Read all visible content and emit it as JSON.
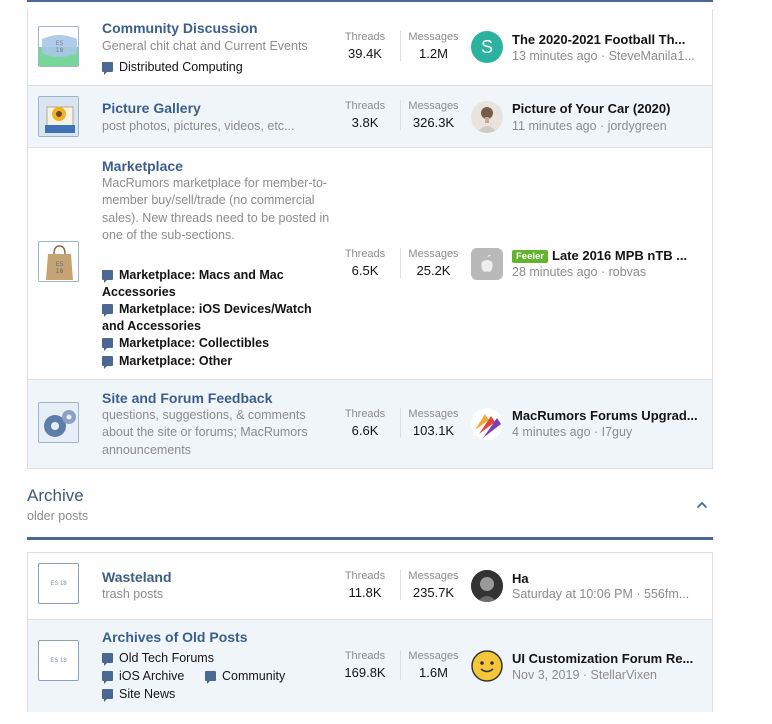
{
  "forums_block": {
    "rows": [
      {
        "title": "Community Discussion",
        "description": "General chit chat and Current Events",
        "subforums": [
          "Distributed Computing"
        ],
        "threads_label": "Threads",
        "threads": "39.4K",
        "messages_label": "Messages",
        "messages": "1.2M",
        "latest_title": "The 2020-2021 Football Th...",
        "latest_meta": "13 minutes ago · SteveManila1...",
        "avatar_letter": "S",
        "avatar_color": "#2bb3a0"
      },
      {
        "title": "Picture Gallery",
        "description": "post photos, pictures, videos, etc...",
        "threads_label": "Threads",
        "threads": "3.8K",
        "messages_label": "Messages",
        "messages": "326.3K",
        "latest_title": "Picture of Your Car (2020)",
        "latest_meta": "11 minutes ago · jordygreen"
      },
      {
        "title": "Marketplace",
        "description": "MacRumors marketplace for member-to-member buy/sell/trade (no commercial sales). New threads need to be posted in one of the sub-sections.",
        "subforums": [
          "Marketplace: Macs and Mac Accessories",
          "Marketplace: iOS Devices/Watch and Accessories",
          "Marketplace: Collectibles",
          "Marketplace: Other"
        ],
        "threads_label": "Threads",
        "threads": "6.5K",
        "messages_label": "Messages",
        "messages": "25.2K",
        "prefix": "Feeler",
        "latest_title": "Late 2016 MPB nTB ...",
        "latest_meta": "28 minutes ago · robvas"
      },
      {
        "title": "Site and Forum Feedback",
        "description": "questions, suggestions, & comments about the site or forums; MacRumors announcements",
        "threads_label": "Threads",
        "threads": "6.6K",
        "messages_label": "Messages",
        "messages": "103.1K",
        "latest_title": "MacRumors Forums Upgrad...",
        "latest_meta": "4 minutes ago · I7guy"
      }
    ]
  },
  "archive": {
    "title": "Archive",
    "subtitle": "older posts",
    "rows": [
      {
        "title": "Wasteland",
        "description": "trash posts",
        "threads_label": "Threads",
        "threads": "11.8K",
        "messages_label": "Messages",
        "messages": "235.7K",
        "latest_title": "Ha",
        "latest_meta": "Saturday at 10:06 PM · 556fm..."
      },
      {
        "title": "Archives of Old Posts",
        "subforums": [
          "Old Tech Forums",
          "iOS Archive",
          "Community",
          "Site News"
        ],
        "threads_label": "Threads",
        "threads": "169.8K",
        "messages_label": "Messages",
        "messages": "1.6M",
        "latest_title": "UI Customization Forum Re...",
        "latest_meta": "Nov 3, 2019 · StellarVixen"
      }
    ]
  },
  "icons": {
    "forum_icon_caption": "ES 18",
    "collapse": "chevron-up-icon",
    "subforum": "chat-bubble-icon"
  },
  "colors": {
    "link": "#3b5f8a",
    "accent_bar": "#4b6892",
    "feeler_badge": "#63b32e",
    "alt_row": "#f0f5fa"
  }
}
